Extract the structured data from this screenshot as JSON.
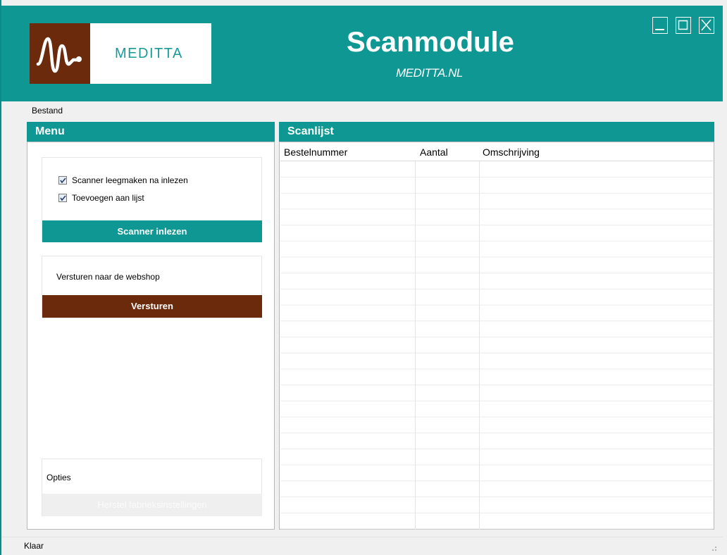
{
  "app": {
    "title": "Scanmodule",
    "subtitle": "MEDITTA.NL",
    "logo_text": "MEDITTA",
    "brand_color": "#0e9793",
    "accent_color": "#6b2a0c"
  },
  "window_controls": [
    "minimize-icon",
    "maximize-icon",
    "close-icon"
  ],
  "menubar": {
    "items": [
      {
        "label": "Bestand"
      }
    ]
  },
  "menu_panel": {
    "title": "Menu",
    "scan_card": {
      "options": [
        {
          "label": "Scanner leegmaken na inlezen",
          "checked": true
        },
        {
          "label": "Toevoegen aan lijst",
          "checked": true
        }
      ],
      "button_label": "Scanner inlezen"
    },
    "send_card": {
      "label": "Versturen naar de webshop",
      "button_label": "Versturen"
    },
    "options_card": {
      "label": "Opties",
      "button_label": "Herstel fabrieksinstellingen"
    }
  },
  "scan_panel": {
    "title": "Scanlijst",
    "columns": [
      "Bestelnummer",
      "Aantal",
      "Omschrijving"
    ],
    "rows": []
  },
  "status": {
    "text": "Klaar"
  }
}
